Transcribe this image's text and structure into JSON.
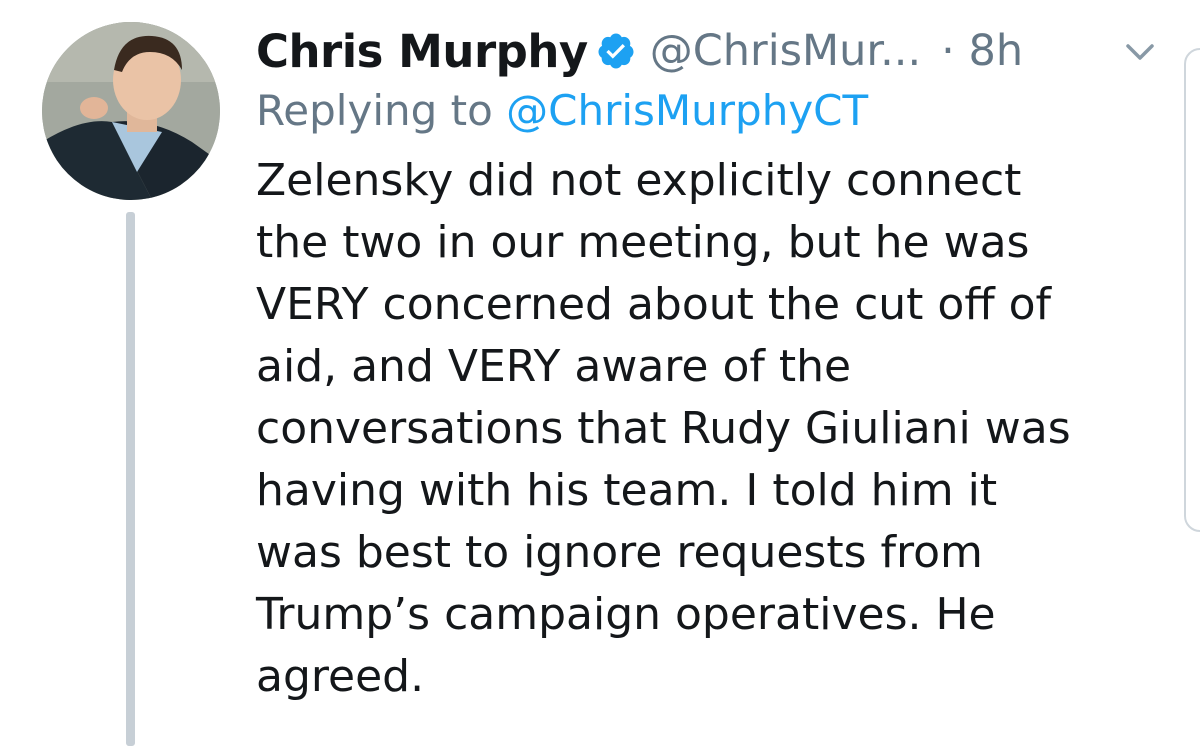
{
  "author": {
    "name": "Chris Murphy",
    "handle": "@ChrisMur...",
    "time": "· 8h",
    "verified_icon": "verified-badge-icon",
    "avatar_icon": "profile-photo"
  },
  "reply": {
    "prefix": "Replying to",
    "handle": "@ChrisMurphyCT"
  },
  "tweet": {
    "lines": [
      "Zelensky did not explicitly connect",
      "the two in our meeting, but he was",
      "VERY concerned about the cut off of",
      "aid, and VERY aware of the",
      "conversations that Rudy Giuliani was",
      "having with his team. I told him it",
      "was best to ignore requests from",
      "Trump’s campaign operatives. He",
      "agreed."
    ]
  },
  "colors": {
    "text": "#14171a",
    "secondary": "#657786",
    "link": "#1da1f2",
    "thread_line": "#c7cfd6"
  }
}
